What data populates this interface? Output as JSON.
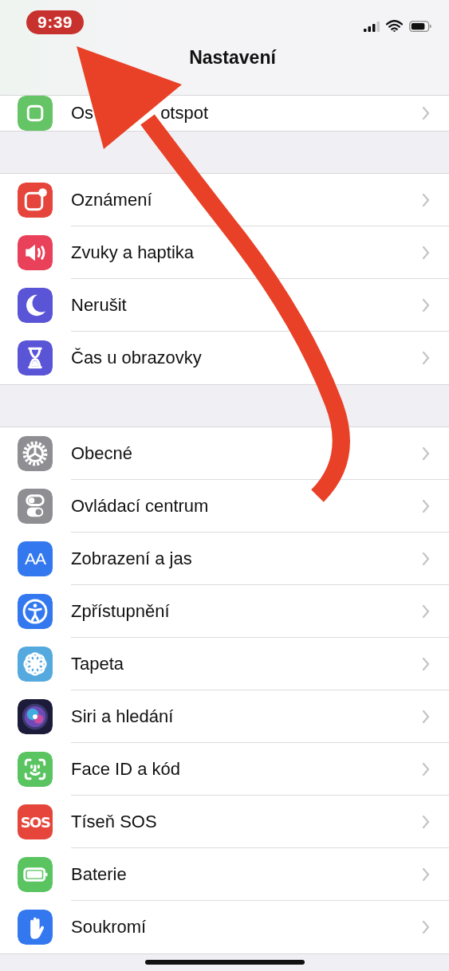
{
  "status_bar": {
    "time": "9:39",
    "time_highlighted": true
  },
  "nav": {
    "title": "Nastavení"
  },
  "partial_row": {
    "kind": "hotspot",
    "color": "#65c466",
    "label_parts": [
      "Os",
      "otspot"
    ]
  },
  "groups": [
    {
      "items": [
        {
          "label": "Oznámení",
          "kind": "notifications",
          "color": "#e5453a"
        },
        {
          "label": "Zvuky a haptika",
          "kind": "speaker",
          "color": "#e94159"
        },
        {
          "label": "Nerušit",
          "kind": "moon",
          "color": "#5a55d6"
        },
        {
          "label": "Čas u obrazovky",
          "kind": "hourglass",
          "color": "#5a55d6"
        }
      ]
    },
    {
      "items": [
        {
          "label": "Obecné",
          "kind": "gear",
          "color": "#8e8e93"
        },
        {
          "label": "Ovládací centrum",
          "kind": "toggles",
          "color": "#8e8e93"
        },
        {
          "label": "Zobrazení a jas",
          "kind": "text",
          "icon_text": "AA",
          "color": "#3478f0"
        },
        {
          "label": "Zpřístupnění",
          "kind": "accessibility",
          "color": "#3478f0"
        },
        {
          "label": "Tapeta",
          "kind": "flower",
          "color": "#54a9de"
        },
        {
          "label": "Siri a hledání",
          "kind": "orb",
          "color": "#1c1c3a"
        },
        {
          "label": "Face ID a kód",
          "kind": "face",
          "color": "#5ac461"
        },
        {
          "label": "Tíseň SOS",
          "kind": "text",
          "icon_text": "SOS",
          "color": "#e5453a"
        },
        {
          "label": "Baterie",
          "kind": "battery",
          "color": "#5ac461"
        },
        {
          "label": "Soukromí",
          "kind": "hand",
          "color": "#3478f0"
        }
      ]
    }
  ],
  "annotation": {
    "kind": "arrow",
    "color": "#e84127"
  }
}
